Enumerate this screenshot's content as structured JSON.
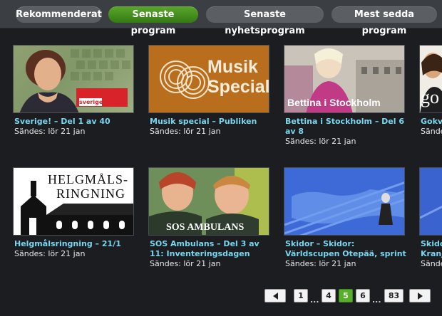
{
  "tabs": [
    {
      "label": "Rekommenderat",
      "active": false
    },
    {
      "label": "Senaste program",
      "active": true
    },
    {
      "label": "Senaste nyhetsprogram",
      "active": false
    },
    {
      "label": "Mest sedda program",
      "active": false
    }
  ],
  "programs": [
    {
      "title": "Sverige! – Del 1 av 40",
      "air": "Sändes: lör 21 jan",
      "thumb_badge": "sverige!"
    },
    {
      "title": "Musik special – Publiken",
      "air": "Sändes: lör 21 jan",
      "thumb_text_1": "Musik",
      "thumb_text_2": "Special"
    },
    {
      "title": "Bettina i Stockholm – Del 6 av 8",
      "air": "Sändes: lör 21 jan",
      "thumb_text": "Bettina i Stockholm"
    },
    {
      "title": "Gokv",
      "air": "Sände",
      "thumb_text": "go"
    },
    {
      "title": "Helgmålsringning – 21/1",
      "air": "Sändes: lör 21 jan",
      "thumb_text_1": "HELGMÅLS-",
      "thumb_text_2": "RINGNING"
    },
    {
      "title": "SOS Ambulans – Del 3 av 11: Inventeringsdagen",
      "air": "Sändes: lör 21 jan",
      "thumb_text": "SOS AMBULANS"
    },
    {
      "title": "Skidor – Skidor: Världscupen Otepää, sprint",
      "air": "Sändes: lör 21 jan"
    },
    {
      "title": "Skido Kranj",
      "air": "Sände"
    }
  ],
  "pager": {
    "pages": [
      "1",
      "4",
      "5",
      "6",
      "83"
    ],
    "current": "5",
    "ellipsis": "..."
  },
  "colors": {
    "accent": "#4f9f24",
    "title_text": "#7ad6ef",
    "background": "#1b1d20"
  }
}
